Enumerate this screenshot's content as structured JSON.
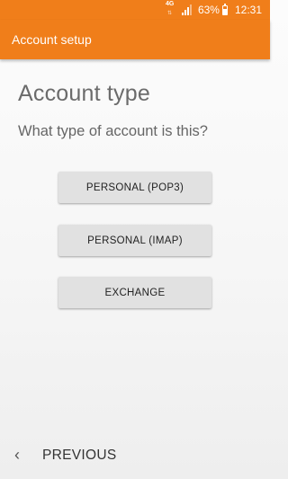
{
  "status_bar": {
    "network": "4G",
    "battery_percent": "63%",
    "battery_level": 0.63,
    "time": "12:31"
  },
  "app_bar": {
    "title": "Account setup"
  },
  "main": {
    "heading": "Account type",
    "question": "What type of account is this?",
    "options": [
      "PERSONAL (POP3)",
      "PERSONAL (IMAP)",
      "EXCHANGE"
    ]
  },
  "footer": {
    "previous_label": "PREVIOUS",
    "previous_icon": "chevron-left-icon"
  },
  "colors": {
    "accent": "#f07e1a",
    "button_bg": "#e1e1e1"
  }
}
